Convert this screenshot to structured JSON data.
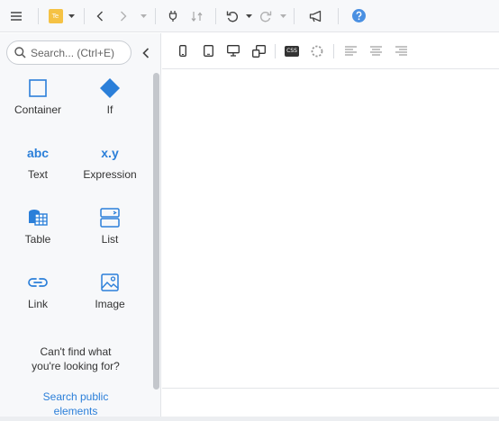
{
  "app": {
    "page_badge": "Te",
    "accent_color": "#2b7fd9",
    "help_color": "#4a90e2"
  },
  "toolbar": {
    "icons": [
      "menu-icon",
      "page-badge",
      "back-icon",
      "forward-icon",
      "plug-icon",
      "sort-icon",
      "undo-icon",
      "redo-icon",
      "megaphone-icon",
      "help-icon"
    ]
  },
  "sidebar": {
    "search": {
      "placeholder": "Search... (Ctrl+E)",
      "value": ""
    },
    "elements": [
      {
        "label": "Container",
        "icon": "square-icon"
      },
      {
        "label": "If",
        "icon": "diamond-icon"
      },
      {
        "label": "Text",
        "icon_text": "abc"
      },
      {
        "label": "Expression",
        "icon_text": "x.y"
      },
      {
        "label": "Table",
        "icon": "table-icon"
      },
      {
        "label": "List",
        "icon": "list-icon"
      },
      {
        "label": "Link",
        "icon": "link-icon"
      },
      {
        "label": "Image",
        "icon": "image-icon"
      }
    ],
    "help_text_line1": "Can't find what",
    "help_text_line2": "you're looking for?",
    "help_link_line1": "Search public",
    "help_link_line2": "elements"
  },
  "canvas_toolbar": {
    "css_label": "CSS",
    "icons": [
      "mobile-icon",
      "tablet-icon",
      "desktop-icon",
      "responsive-icon",
      "css-icon",
      "loading-icon",
      "align-left-icon",
      "align-center-icon",
      "align-right-icon"
    ]
  }
}
